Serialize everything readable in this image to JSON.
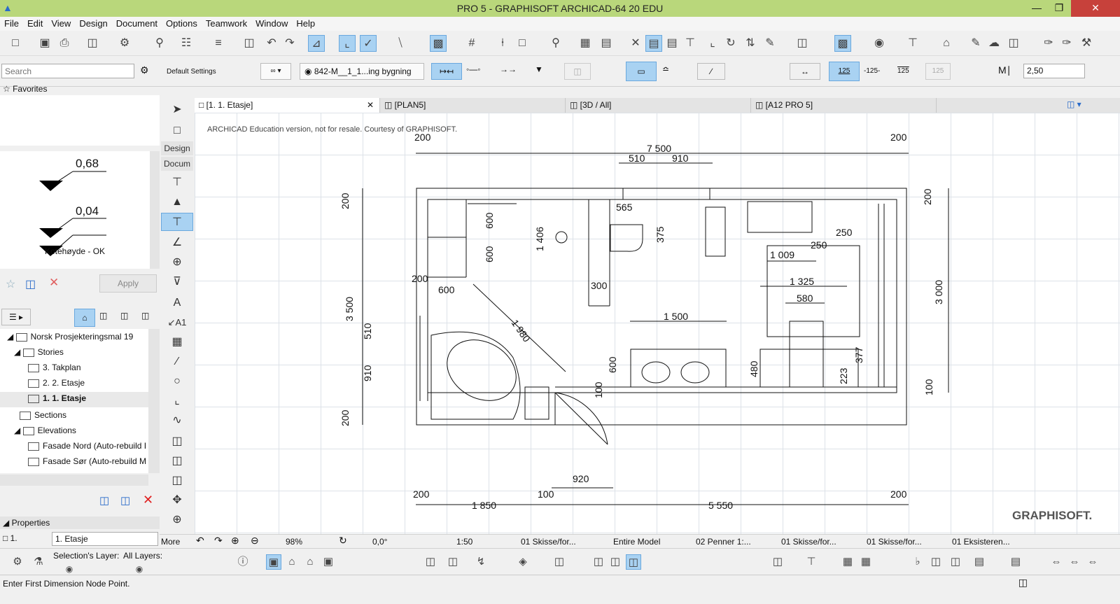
{
  "window": {
    "title": "PRO 5 - GRAPHISOFT ARCHICAD-64 20 EDU"
  },
  "menu": [
    "File",
    "Edit",
    "View",
    "Design",
    "Document",
    "Options",
    "Teamwork",
    "Window",
    "Help"
  ],
  "infobox": {
    "settings_label": "Default Settings",
    "view_dropdown": "842-M__1_1...ing bygning",
    "scale_125": "125",
    "scale_125b": "-125-",
    "scale_125c": "125",
    "scale_125d": "125",
    "value_field": "2,50"
  },
  "search": {
    "placeholder": "Search"
  },
  "favorites": {
    "label": "Favorites"
  },
  "dim_preview": {
    "val1": "0,68",
    "val2": "0,04",
    "caption": "Kotehøyde - OK",
    "apply": "Apply"
  },
  "navigator": {
    "root": "Norsk Prosjekteringsmal 19",
    "stories": "Stories",
    "items": [
      "3. Takplan",
      "2. 2. Etasje",
      "1. 1. Etasje"
    ],
    "sections": "Sections",
    "elevations": "Elevations",
    "elev_items": [
      "Fasade Nord (Auto-rebuild I",
      "Fasade Sør (Auto-rebuild M"
    ]
  },
  "properties": {
    "header": "Properties",
    "id": "1.",
    "name": "1. Etasje",
    "more": "More"
  },
  "toolbox": {
    "design": "Design",
    "docum": "Docum"
  },
  "tabs": [
    {
      "label": "[1. 1. Etasje]",
      "active": true
    },
    {
      "label": "[PLAN5]"
    },
    {
      "label": "[3D / All]"
    },
    {
      "label": "[A12 PRO 5]"
    }
  ],
  "canvas": {
    "edu_note": "ARCHICAD Education version, not for resale. Courtesy of GRAPHISOFT.",
    "brand": "GRAPHISOFT.",
    "dims": [
      "200",
      "7 500",
      "200",
      "510",
      "910",
      "565",
      "200",
      "600",
      "600",
      "1 406",
      "375",
      "250",
      "250",
      "1 009",
      "200",
      "3 500",
      "200",
      "600",
      "1 980",
      "300",
      "1 325",
      "3 000",
      "510",
      "580",
      "1 500",
      "910",
      "480",
      "377",
      "100",
      "600",
      "223",
      "100",
      "920",
      "200",
      "100",
      "200",
      "1 850",
      "5 550",
      "200"
    ]
  },
  "status_row": {
    "zoom": "98%",
    "angle": "0,0°",
    "scale": "1:50",
    "layer1": "01 Skisse/for...",
    "model": "Entire Model",
    "pens": "02 Penner 1:...",
    "layer2": "01 Skisse/for...",
    "layer3": "01 Skisse/for...",
    "layer4": "01 Eksisteren..."
  },
  "bottom": {
    "sel_layer": "Selection's Layer:",
    "all_layers": "All Layers:"
  },
  "statusline": "Enter First Dimension Node Point."
}
